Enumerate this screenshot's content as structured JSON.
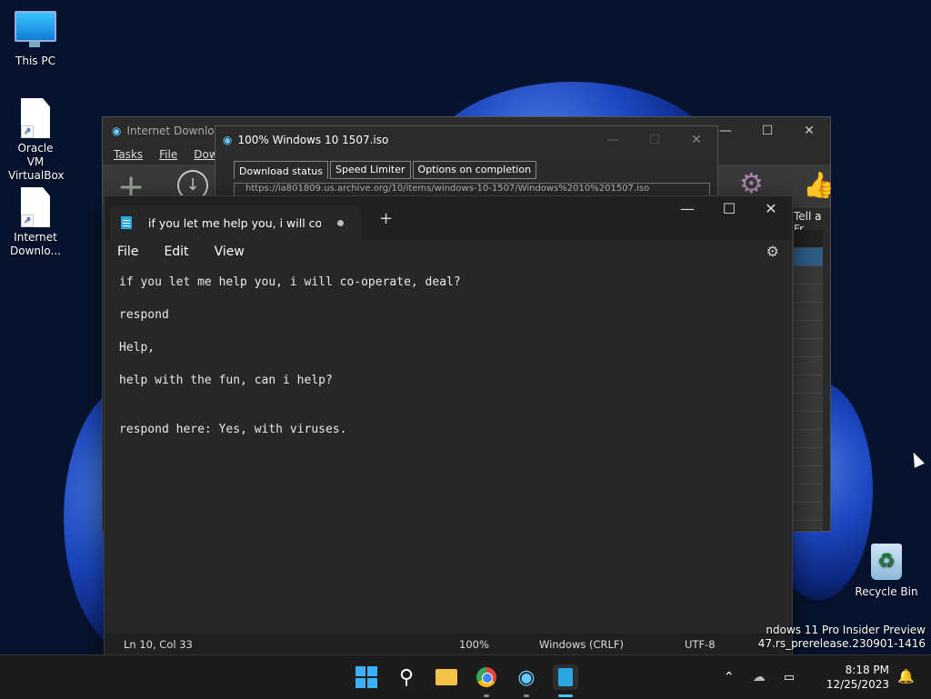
{
  "desktop": {
    "icons": [
      {
        "label": "This PC"
      },
      {
        "label": "Oracle VM VirtualBox"
      },
      {
        "label": "Internet Downlo..."
      },
      {
        "label": "Recycle Bin"
      }
    ],
    "watermark": {
      "line1": "ndows 11 Pro Insider Preview",
      "line2": "47.rs_prerelease.230901-1416"
    }
  },
  "idm_main": {
    "title": "Internet Downloa",
    "menu": [
      "Tasks",
      "File",
      "Dow"
    ],
    "toolbar_label": "Tell a Fr"
  },
  "idm_dialog": {
    "title": "100% Windows 10 1507.iso",
    "tabs": [
      "Download status",
      "Speed Limiter",
      "Options on completion"
    ],
    "url": "https://ia801809.us.archive.org/10/items/windows-10-1507/Windows%2010%201507.iso"
  },
  "notepad": {
    "tab_title": "if you let me help you, i will co-o",
    "menu": [
      "File",
      "Edit",
      "View"
    ],
    "content": "if you let me help you, i will co-operate, deal?\n\nrespond\n\nHelp,\n\nhelp with the fun, can i help?\n\n\nrespond here: Yes, with viruses.",
    "status": {
      "position": "Ln 10, Col 33",
      "zoom": "100%",
      "line_ending": "Windows (CRLF)",
      "encoding": "UTF-8"
    }
  },
  "taskbar": {
    "time": "8:18 PM",
    "date": "12/25/2023"
  }
}
